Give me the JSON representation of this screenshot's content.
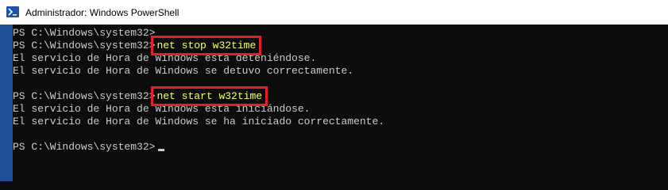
{
  "window": {
    "title": "Administrador: Windows PowerShell",
    "app_icon": "powershell-icon"
  },
  "console": {
    "lines": [
      {
        "prompt": "PS C:\\Windows\\system32>",
        "command": ""
      },
      {
        "prompt": "PS C:\\Windows\\system32>",
        "command": "net stop w32time"
      },
      {
        "output": "El servicio de Hora de Windows está deteniéndose."
      },
      {
        "output": "El servicio de Hora de Windows se detuvo correctamente."
      },
      {
        "output": ""
      },
      {
        "prompt": "PS C:\\Windows\\system32>",
        "command": "net start w32time"
      },
      {
        "output": "El servicio de Hora de Windows está iniciándose."
      },
      {
        "output": "El servicio de Hora de Windows se ha iniciado correctamente."
      },
      {
        "output": ""
      },
      {
        "prompt": "PS C:\\Windows\\system32>",
        "command": ""
      }
    ]
  },
  "colors": {
    "background": "#0c0c0c",
    "text": "#cccccc",
    "command": "#ffff66",
    "highlight_box": "#e0202a",
    "window_border": "#1e4f9b"
  }
}
